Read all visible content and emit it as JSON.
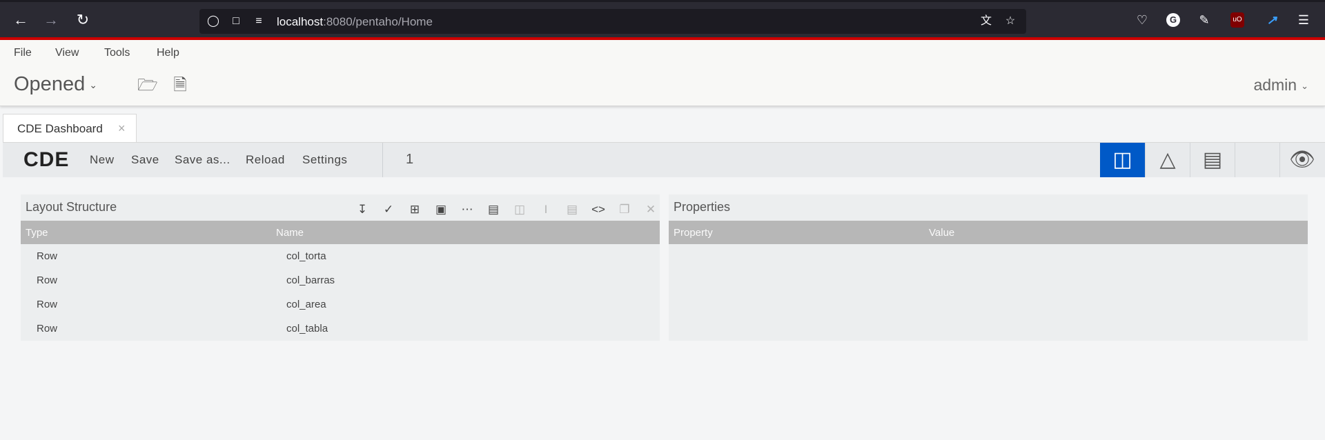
{
  "browser": {
    "url_host": "localhost",
    "url_path": ":8080/pentaho/Home",
    "icons": [
      "back-arrow-icon",
      "forward-arrow-icon",
      "reload-icon",
      "shield-icon",
      "page-icon",
      "permissions-icon",
      "translate-icon",
      "bookmark-star-icon",
      "pocket-icon",
      "grammarly-icon",
      "extensions-icon",
      "ublock-icon",
      "extension-icon",
      "hamburger-menu-icon"
    ],
    "grammarly_label": "G",
    "ublock_label": "uO"
  },
  "menu": {
    "file": "File",
    "view": "View",
    "tools": "Tools",
    "help": "Help"
  },
  "header": {
    "perspective": "Opened",
    "user": "admin"
  },
  "tab": {
    "label": "CDE Dashboard",
    "close": "×"
  },
  "cde": {
    "logo": "CDE",
    "buttons": {
      "new": "New",
      "save": "Save",
      "save_as": "Save as...",
      "reload": "Reload",
      "settings": "Settings"
    },
    "page_number": "1",
    "active_mode": "layout"
  },
  "layout_panel": {
    "title": "Layout Structure",
    "columns": {
      "type": "Type",
      "name": "Name"
    },
    "rows": [
      {
        "type": "Row",
        "name": "col_torta"
      },
      {
        "type": "Row",
        "name": "col_barras"
      },
      {
        "type": "Row",
        "name": "col_area"
      },
      {
        "type": "Row",
        "name": "col_tabla"
      }
    ]
  },
  "properties_panel": {
    "title": "Properties",
    "columns": {
      "property": "Property",
      "value": "Value"
    }
  },
  "colors": {
    "accent_red": "#cc0000",
    "active_blue": "#0059c7",
    "header_gray": "#b7b7b7"
  }
}
